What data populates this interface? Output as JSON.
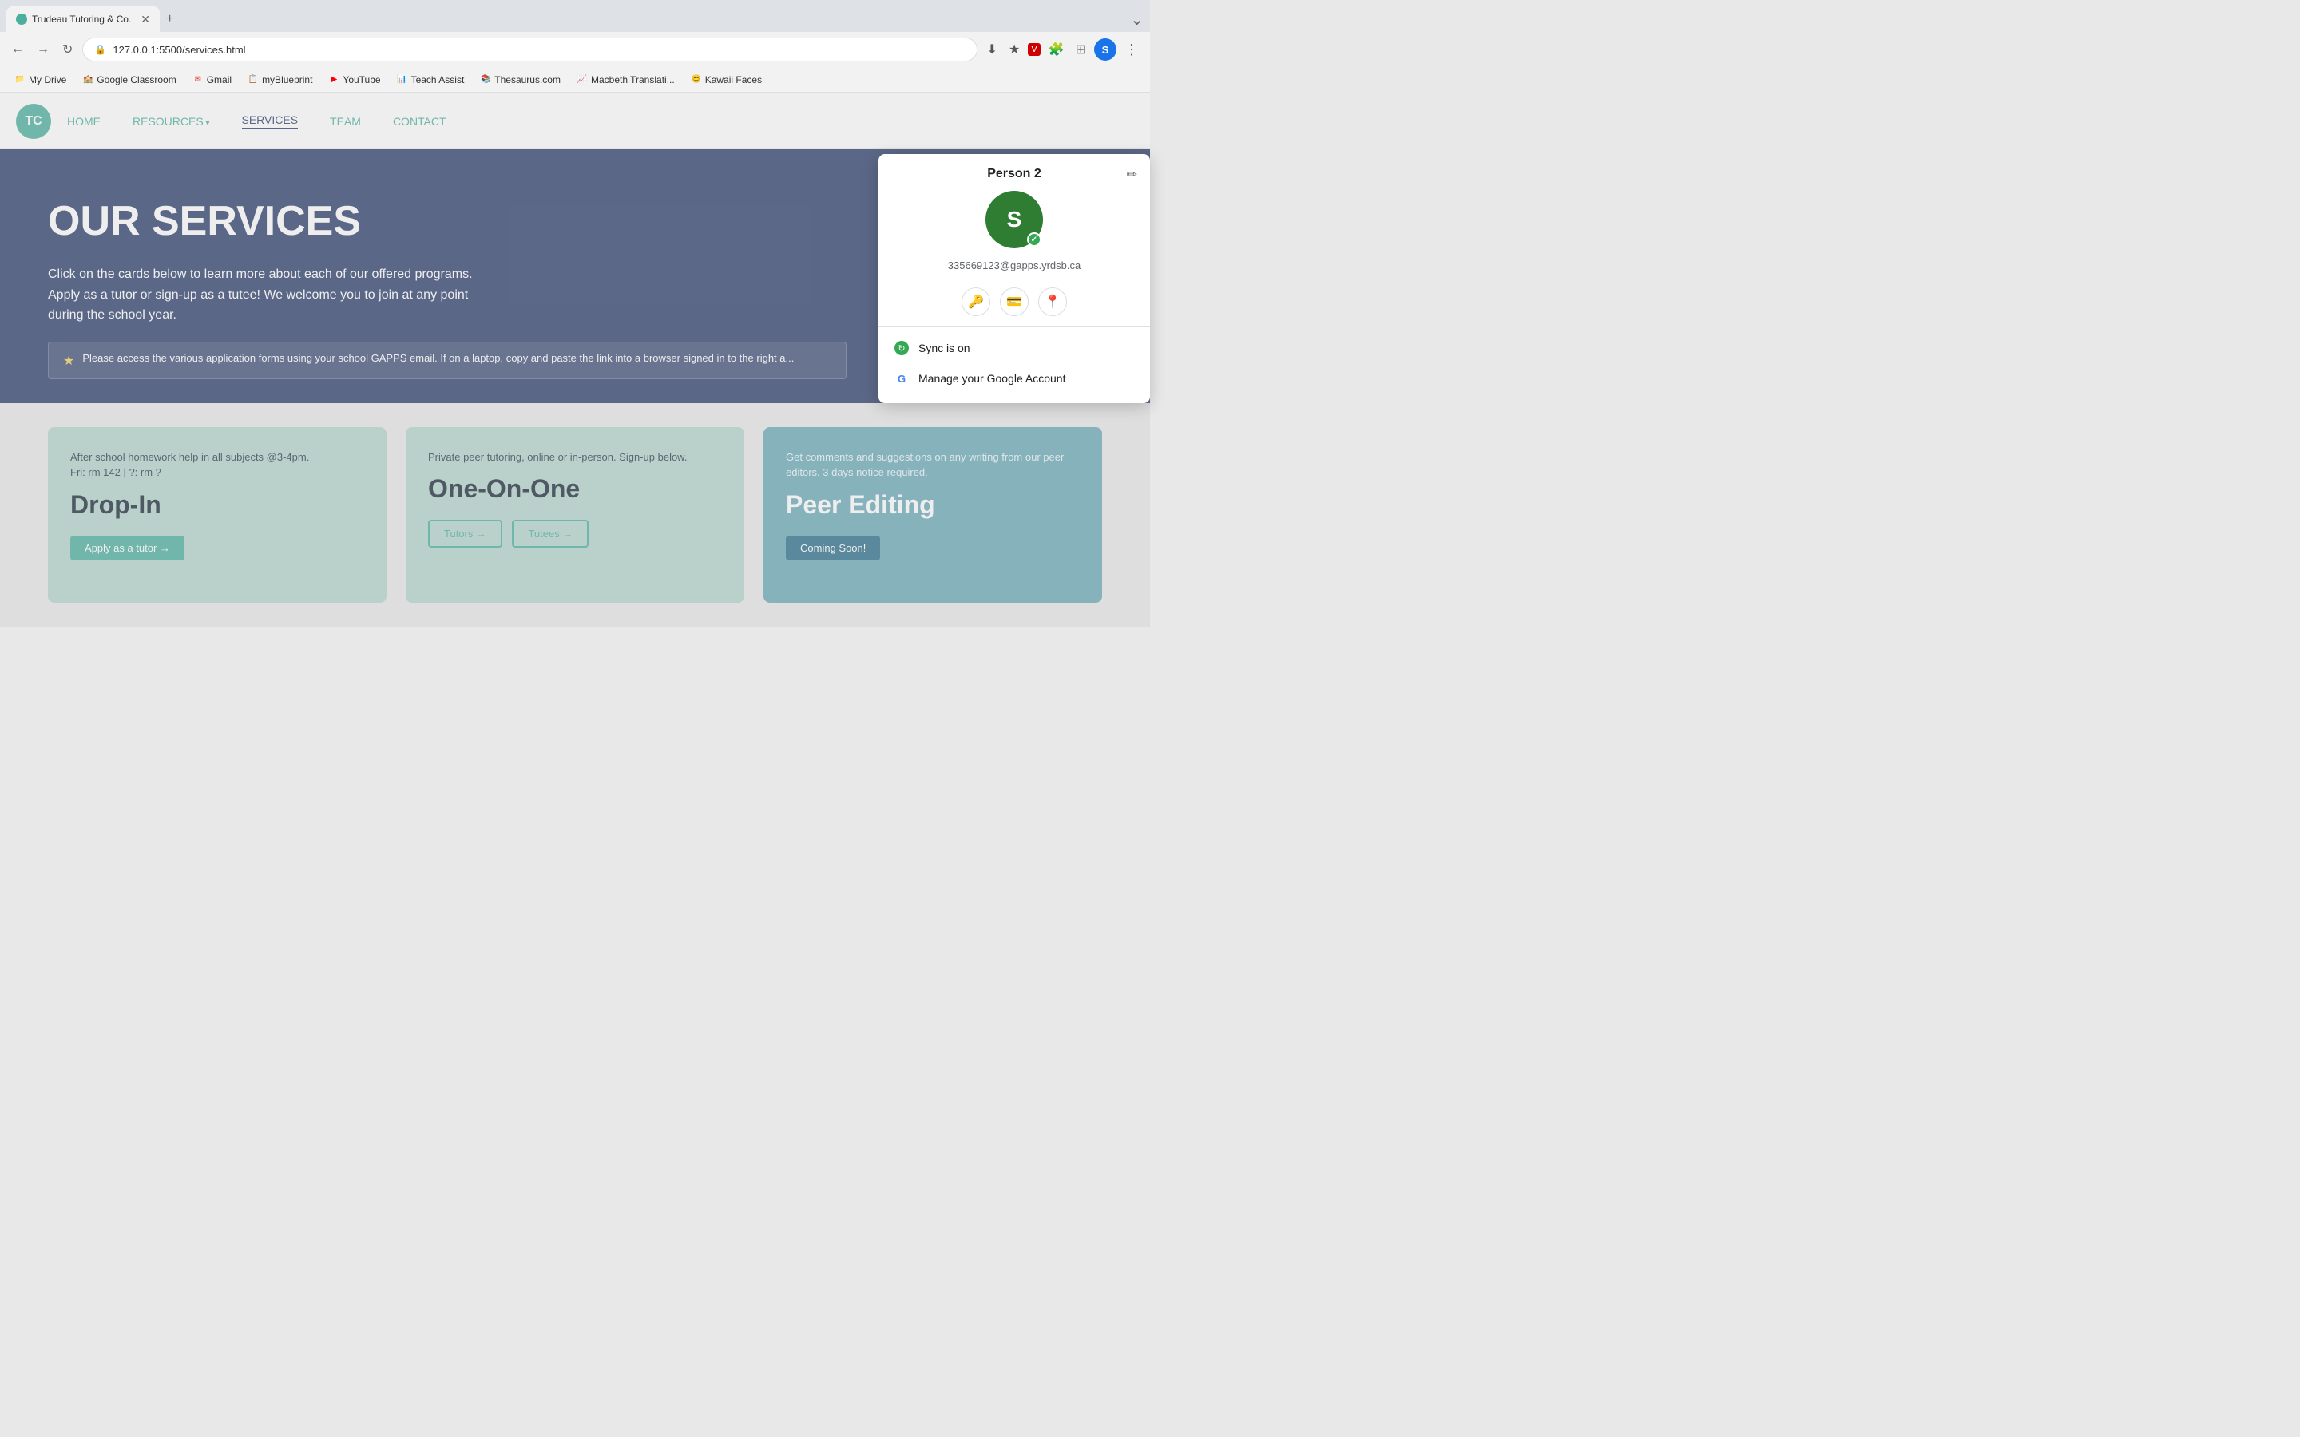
{
  "browser": {
    "tab": {
      "title": "Trudeau Tutoring & Co.",
      "favicon_label": "T"
    },
    "address": "127.0.0.1:5500/services.html",
    "new_tab_label": "+",
    "minimize_label": "⌄"
  },
  "bookmarks": [
    {
      "id": "my-drive",
      "label": "My Drive",
      "icon": "📁",
      "color": "#1a73e8"
    },
    {
      "id": "google-classroom",
      "label": "Google Classroom",
      "icon": "🏫",
      "color": "#0f9d58"
    },
    {
      "id": "gmail",
      "label": "Gmail",
      "icon": "✉",
      "color": "#ea4335"
    },
    {
      "id": "myblueprint",
      "label": "myBlueprint",
      "icon": "📋",
      "color": "#5c4be2"
    },
    {
      "id": "youtube",
      "label": "YouTube",
      "icon": "▶",
      "color": "#ff0000"
    },
    {
      "id": "teach-assist",
      "label": "Teach Assist",
      "icon": "📊",
      "color": "#34a853"
    },
    {
      "id": "thesaurus",
      "label": "Thesaurus.com",
      "icon": "📚",
      "color": "#d93025"
    },
    {
      "id": "macbeth",
      "label": "Macbeth Translati...",
      "icon": "📈",
      "color": "#fbbc04"
    },
    {
      "id": "kawaii",
      "label": "Kawaii Faces",
      "icon": "😊",
      "color": "#9c27b0"
    }
  ],
  "site": {
    "nav": {
      "logo_label": "TC",
      "links": [
        {
          "id": "home",
          "label": "HOME",
          "active": false
        },
        {
          "id": "resources",
          "label": "RESOURCES",
          "active": false,
          "dropdown": true
        },
        {
          "id": "services",
          "label": "SERVICES",
          "active": true
        },
        {
          "id": "team",
          "label": "TEAM",
          "active": false
        },
        {
          "id": "contact",
          "label": "CONTACT",
          "active": false
        }
      ]
    },
    "hero": {
      "title": "OUR SERVICES",
      "description": "Click on the cards below to learn more about each of our offered programs.\nApply as a tutor or sign-up as a tutee! We welcome you to join at any point\nduring the school year.",
      "notice": "★  Please access the various application forms using your school GAPPS email. If on a laptop, copy and paste the link into a browser signed in to the right a..."
    },
    "cards": [
      {
        "id": "drop-in",
        "desc": "After school homework help in all subjects @3-4pm.\nFri: rm 142 | ?: rm ?",
        "title": "Drop-In",
        "buttons": [
          {
            "label": "Apply as a tutor →",
            "style": "filled"
          }
        ]
      },
      {
        "id": "one-on-one",
        "desc": "Private peer tutoring, online or in-person. Sign-up below.",
        "title": "One-On-One",
        "buttons": [
          {
            "label": "Tutors →",
            "style": "outlined"
          },
          {
            "label": "Tutees →",
            "style": "outlined"
          }
        ]
      },
      {
        "id": "peer-editing",
        "desc": "Get comments and suggestions on any writing from our peer editors. 3 days notice required.",
        "title": "Peer Editing",
        "buttons": [
          {
            "label": "Coming Soon!",
            "style": "blue"
          }
        ],
        "dark": true
      }
    ]
  },
  "profile_dropdown": {
    "name": "Person 2",
    "avatar_letter": "S",
    "email": "335669123@gapps.yrdsb.ca",
    "sync_label": "Sync is on",
    "manage_account_label": "Manage your Google Account",
    "icons": [
      {
        "id": "key-icon",
        "symbol": "🔑"
      },
      {
        "id": "card-icon",
        "symbol": "💳"
      },
      {
        "id": "location-icon",
        "symbol": "📍"
      }
    ]
  }
}
